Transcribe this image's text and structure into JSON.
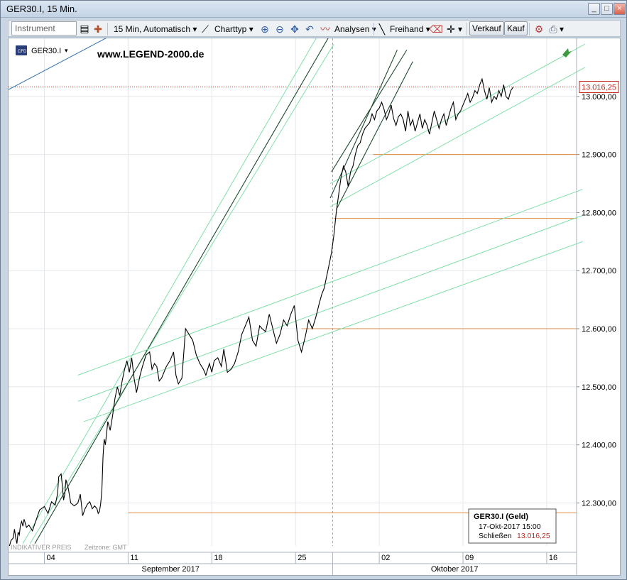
{
  "window": {
    "title": "GER30.I, 15 Min."
  },
  "toolbar": {
    "instrument_placeholder": "Instrument",
    "interval": "15 Min,",
    "interval_mode": "Automatisch",
    "chart_type": "Charttyp",
    "analyses": "Analysen",
    "freehand": "Freihand",
    "sell": "Verkauf",
    "buy": "Kauf"
  },
  "chart": {
    "symbol": "GER30.I",
    "watermark": "www.LEGEND-2000.de",
    "footer_left": "INDIKATIVER PREIS",
    "timezone": "Zeitzone: GMT",
    "last_price": "13.016,25",
    "info_title": "GER30.I (Geld)",
    "info_date": "17-Okt-2017 15:00",
    "info_close_label": "Schließen",
    "info_close_value": "13.016,25",
    "month_sep": "September 2017",
    "month_oct": "Oktober 2017"
  },
  "colors": {
    "price": "#000000",
    "trend_light": "#7fe0a8",
    "trend_dark": "#1e4a2e",
    "support": "#e0883c",
    "blue_line": "#2f6fb0",
    "last_price": "#c0281e"
  },
  "chart_data": {
    "type": "line",
    "xlabel": "",
    "ylabel": "",
    "ylim": [
      12215,
      13100
    ],
    "y_ticks": [
      "12.300,00",
      "12.400,00",
      "12.500,00",
      "12.600,00",
      "12.700,00",
      "12.800,00",
      "12.900,00",
      "13.000,00"
    ],
    "y_tick_values": [
      12300,
      12400,
      12500,
      12600,
      12700,
      12800,
      12900,
      13000
    ],
    "x_ticks": [
      "04",
      "11",
      "18",
      "25",
      "02",
      "09",
      "16"
    ],
    "x_tick_days": [
      3,
      10,
      17,
      24,
      31,
      38,
      45
    ],
    "x_range_days": [
      0,
      47.5
    ],
    "month_boundary_day": 27.1,
    "series": [
      {
        "values_x_days": [
          0,
          0.2,
          0.4,
          0.5,
          0.6,
          0.7,
          0.8,
          0.9,
          1,
          1.1,
          1.2,
          1.3,
          1.5,
          1.7,
          2,
          2.3,
          2.6,
          3,
          3.3,
          3.6,
          3.9,
          4.1,
          4.2,
          4.4,
          4.5,
          4.6,
          4.7,
          4.8,
          5,
          5.2,
          5.5,
          5.8,
          6,
          6.2,
          6.4,
          6.6,
          6.8,
          7,
          7.2,
          7.4,
          7.5,
          7.6,
          7.7,
          7.8,
          7.9,
          8,
          8.1,
          8.2,
          8.3,
          8.5,
          8.7,
          8.9,
          9.1,
          9.3,
          9.5,
          9.7,
          9.9,
          10.1,
          10.3,
          10.5,
          10.7,
          11,
          11.2,
          11.5,
          11.8,
          12,
          12.2,
          12.4,
          12.6,
          12.8,
          13,
          13.2,
          13.5,
          13.8,
          14,
          14.2,
          14.5,
          14.8,
          15.1,
          15.4,
          15.7,
          16,
          16.3,
          16.5,
          16.8,
          17,
          17.2,
          17.5,
          17.8,
          18,
          18.3,
          18.6,
          18.9,
          19.2,
          19.5,
          19.8,
          20.1,
          20.4,
          20.7,
          21,
          21.2,
          21.5,
          21.8,
          22.1,
          22.4,
          22.7,
          23,
          23.3,
          23.6,
          23.9,
          24.2,
          24.5,
          24.8,
          25.1,
          25.4,
          25.7,
          26,
          26.2,
          26.4,
          26.6,
          26.8,
          27,
          27.2,
          27.4,
          27.6,
          27.8,
          28,
          28.2,
          28.4,
          28.6,
          28.8,
          29,
          29.2,
          29.4,
          29.6,
          29.8,
          30,
          30.2,
          30.4,
          30.6,
          30.8,
          31,
          31.2,
          31.4,
          31.6,
          31.8,
          32,
          32.2,
          32.4,
          32.6,
          32.8,
          33,
          33.2,
          33.4,
          33.6,
          33.8,
          34,
          34.2,
          34.4,
          34.6,
          34.8,
          35,
          35.2,
          35.4,
          35.6,
          35.8,
          36,
          36.2,
          36.4,
          36.6,
          36.8,
          37,
          37.2,
          37.4,
          37.6,
          37.8,
          38,
          38.2,
          38.4,
          38.6,
          38.8,
          39,
          39.2,
          39.4,
          39.6,
          39.8,
          40,
          40.2,
          40.4,
          40.6,
          40.8,
          41,
          41.2,
          41.4,
          41.6,
          41.8,
          42,
          42.2,
          42.4,
          42.6,
          42.8,
          43,
          43.2,
          43.4,
          43.6,
          43.8,
          44,
          44.2,
          44.4,
          44.6,
          44.8,
          45,
          45.2,
          45.4,
          45.6,
          45.8,
          46,
          46.2,
          46.4,
          46.6
        ],
        "values": [
          12220,
          12235,
          12240,
          12255,
          12240,
          12230,
          12250,
          12245,
          12262,
          12268,
          12260,
          12272,
          12258,
          12262,
          12252,
          12270,
          12288,
          12294,
          12282,
          12302,
          12296,
          12316,
          12345,
          12350,
          12330,
          12305,
          12315,
          12340,
          12325,
          12300,
          12295,
          12300,
          12315,
          12278,
          12290,
          12298,
          12302,
          12290,
          12295,
          12290,
          12282,
          12285,
          12298,
          12320,
          12380,
          12410,
          12400,
          12420,
          12440,
          12425,
          12450,
          12480,
          12500,
          12485,
          12510,
          12530,
          12545,
          12525,
          12550,
          12515,
          12490,
          12520,
          12535,
          12555,
          12560,
          12530,
          12540,
          12535,
          12510,
          12515,
          12525,
          12535,
          12545,
          12560,
          12520,
          12505,
          12515,
          12600,
          12590,
          12580,
          12555,
          12540,
          12530,
          12520,
          12540,
          12525,
          12545,
          12550,
          12535,
          12565,
          12525,
          12530,
          12540,
          12560,
          12590,
          12605,
          12620,
          12580,
          12570,
          12605,
          12600,
          12595,
          12625,
          12600,
          12575,
          12590,
          12615,
          12605,
          12625,
          12640,
          12580,
          12560,
          12585,
          12615,
          12600,
          12620,
          12645,
          12660,
          12670,
          12690,
          12710,
          12730,
          12760,
          12800,
          12830,
          12860,
          12880,
          12870,
          12845,
          12870,
          12880,
          12900,
          12915,
          12920,
          12935,
          12945,
          12950,
          12955,
          12970,
          12960,
          12975,
          12980,
          12990,
          12978,
          12960,
          12970,
          12985,
          12962,
          12950,
          12965,
          12970,
          12960,
          12940,
          12975,
          12950,
          12960,
          12940,
          12955,
          12970,
          12945,
          12960,
          12950,
          12935,
          12955,
          12975,
          12960,
          12945,
          12960,
          12970,
          12950,
          12965,
          12980,
          12990,
          12960,
          12970,
          12975,
          12985,
          12995,
          13005,
          12990,
          12998,
          13010,
          13005,
          13020,
          13030,
          13010,
          12995,
          13015,
          12990,
          13000,
          12995,
          13010,
          13000,
          13020,
          13000,
          12995,
          13010,
          13016
        ]
      }
    ],
    "support_levels": [
      {
        "value": 12283,
        "from_day": 10.0
      },
      {
        "value": 12600,
        "from_day": 24.5
      },
      {
        "value": 12790,
        "from_day": 27.2
      },
      {
        "value": 12900,
        "from_day": 30.5
      }
    ],
    "trendlines": [
      {
        "style": "light",
        "points": [
          [
            1.2,
            12230
          ],
          [
            26.0,
            13110
          ]
        ]
      },
      {
        "style": "light",
        "points": [
          [
            1.8,
            12230
          ],
          [
            27.2,
            13090
          ]
        ]
      },
      {
        "style": "dark",
        "points": [
          [
            2.2,
            12230
          ],
          [
            27.0,
            13110
          ]
        ]
      },
      {
        "style": "light",
        "points": [
          [
            5.8,
            12520
          ],
          [
            48.0,
            12840
          ]
        ]
      },
      {
        "style": "light",
        "points": [
          [
            5.8,
            12475
          ],
          [
            48.0,
            12795
          ]
        ]
      },
      {
        "style": "light",
        "points": [
          [
            6.3,
            12440
          ],
          [
            48.0,
            12750
          ]
        ]
      },
      {
        "style": "light",
        "points": [
          [
            26.9,
            12810
          ],
          [
            48.2,
            13050
          ]
        ]
      },
      {
        "style": "light",
        "points": [
          [
            26.9,
            12850
          ],
          [
            48.2,
            13090
          ]
        ]
      },
      {
        "style": "dark",
        "points": [
          [
            26.9,
            12825
          ],
          [
            32.5,
            13080
          ]
        ]
      },
      {
        "style": "dark",
        "points": [
          [
            27.0,
            12870
          ],
          [
            33.3,
            13080
          ]
        ]
      },
      {
        "style": "dark",
        "points": [
          [
            27.4,
            12805
          ],
          [
            33.8,
            13060
          ]
        ]
      },
      {
        "style": "blue",
        "points": [
          [
            -2.0,
            12990
          ],
          [
            21.0,
            13240
          ]
        ]
      }
    ],
    "last_price": 13016.25
  }
}
